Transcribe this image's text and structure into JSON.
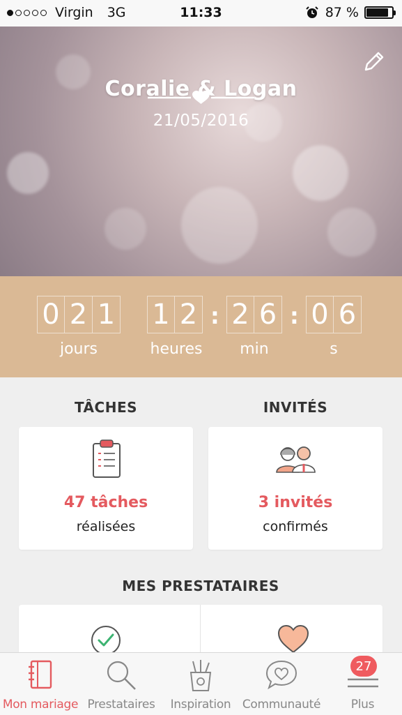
{
  "status_bar": {
    "carrier": "Virgin",
    "network": "3G",
    "time": "11:33",
    "battery": "87 %",
    "battery_level": 0.87
  },
  "wedding": {
    "couple": "Coralie & Logan",
    "date": "21/05/2016"
  },
  "countdown": {
    "days": [
      "0",
      "2",
      "1"
    ],
    "hours": [
      "1",
      "2"
    ],
    "minutes": [
      "2",
      "6"
    ],
    "seconds": [
      "0",
      "6"
    ],
    "labels": {
      "days": "jours",
      "hours": "heures",
      "minutes": "min",
      "seconds": "s"
    }
  },
  "tasks": {
    "title": "TÂCHES",
    "count": "47 tâches",
    "subtitle": "réalisées",
    "icon": "clipboard-icon"
  },
  "guests": {
    "title": "INVITÉS",
    "count": "3 invités",
    "subtitle": "confirmés",
    "icon": "couple-icon"
  },
  "vendors": {
    "title": "MES PRESTATAIRES",
    "icons": [
      "check-circle-icon",
      "heart-icon"
    ]
  },
  "tabbar": {
    "items": [
      {
        "label": "Mon mariage",
        "icon": "notebook-icon",
        "active": true
      },
      {
        "label": "Prestataires",
        "icon": "search-icon"
      },
      {
        "label": "Inspiration",
        "icon": "pencil-cup-icon"
      },
      {
        "label": "Communauté",
        "icon": "chat-heart-icon"
      },
      {
        "label": "Plus",
        "icon": "menu-icon",
        "badge": "27"
      }
    ]
  },
  "colors": {
    "accent": "#e45a5f",
    "countdown_bg": "#dab995",
    "tab_inactive": "#888888",
    "page_bg": "#efefef"
  }
}
